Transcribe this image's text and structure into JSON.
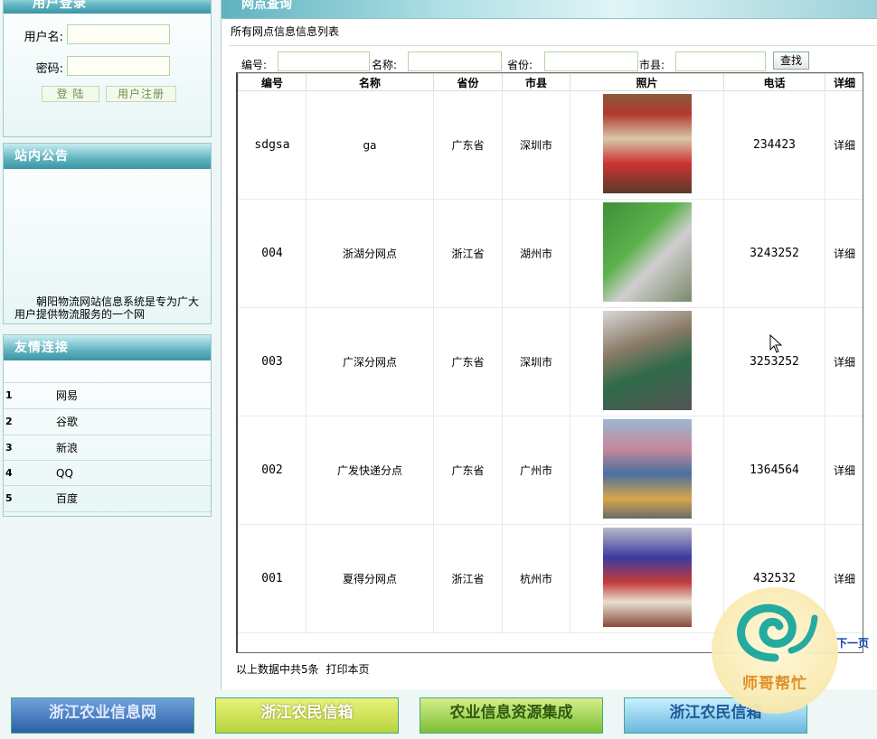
{
  "sidebar": {
    "login": {
      "title": "用户登录",
      "username_label": "用户名:",
      "password_label": "密码:",
      "username_value": "",
      "password_value": "",
      "login_button": "登 陆",
      "register_button": "用户注册"
    },
    "notice": {
      "title": "站内公告",
      "text": "朝阳物流网站信息系统是专为广大用户提供物流服务的一个网"
    },
    "links": {
      "title": "友情连接",
      "items": [
        {
          "num": "1",
          "name": "网易"
        },
        {
          "num": "2",
          "name": "谷歌"
        },
        {
          "num": "3",
          "name": "新浪"
        },
        {
          "num": "4",
          "name": "QQ"
        },
        {
          "num": "5",
          "name": "百度"
        }
      ]
    }
  },
  "main": {
    "header_title": "网点查询",
    "caption": "所有网点信息信息列表",
    "search": {
      "id_label": "编号:",
      "name_label": "名称:",
      "province_label": "省份:",
      "city_label": "市县:",
      "id_value": "",
      "name_value": "",
      "province_value": "",
      "city_value": "",
      "button": "查找"
    },
    "columns": [
      "编号",
      "名称",
      "省份",
      "市县",
      "照片",
      "电话",
      "详细"
    ],
    "rows": [
      {
        "id": "sdgsa",
        "name": "ga",
        "province": "广东省",
        "city": "深圳市",
        "phone": "234423",
        "detail": "详细"
      },
      {
        "id": "004",
        "name": "浙湖分网点",
        "province": "浙江省",
        "city": "湖州市",
        "phone": "3243252",
        "detail": "详细"
      },
      {
        "id": "003",
        "name": "广深分网点",
        "province": "广东省",
        "city": "深圳市",
        "phone": "3253252",
        "detail": "详细"
      },
      {
        "id": "002",
        "name": "广发快递分点",
        "province": "广东省",
        "city": "广州市",
        "phone": "1364564",
        "detail": "详细"
      },
      {
        "id": "001",
        "name": "夏得分网点",
        "province": "浙江省",
        "city": "杭州市",
        "phone": "432532",
        "detail": "详细"
      }
    ],
    "next_page": "下一页",
    "footer_count": "以上数据中共5条",
    "print_link": "打印本页"
  },
  "banners": [
    {
      "text": "浙江农业信息网",
      "color": "#2d5fa8"
    },
    {
      "text": "浙江农民信箱",
      "color": "#c8e04a"
    },
    {
      "text": "农业信息资源集成",
      "color": "#8dc63f"
    },
    {
      "text": "浙江农民信箱",
      "color": "#3a8fcf"
    }
  ],
  "watermark": {
    "text": "师哥帮忙"
  }
}
